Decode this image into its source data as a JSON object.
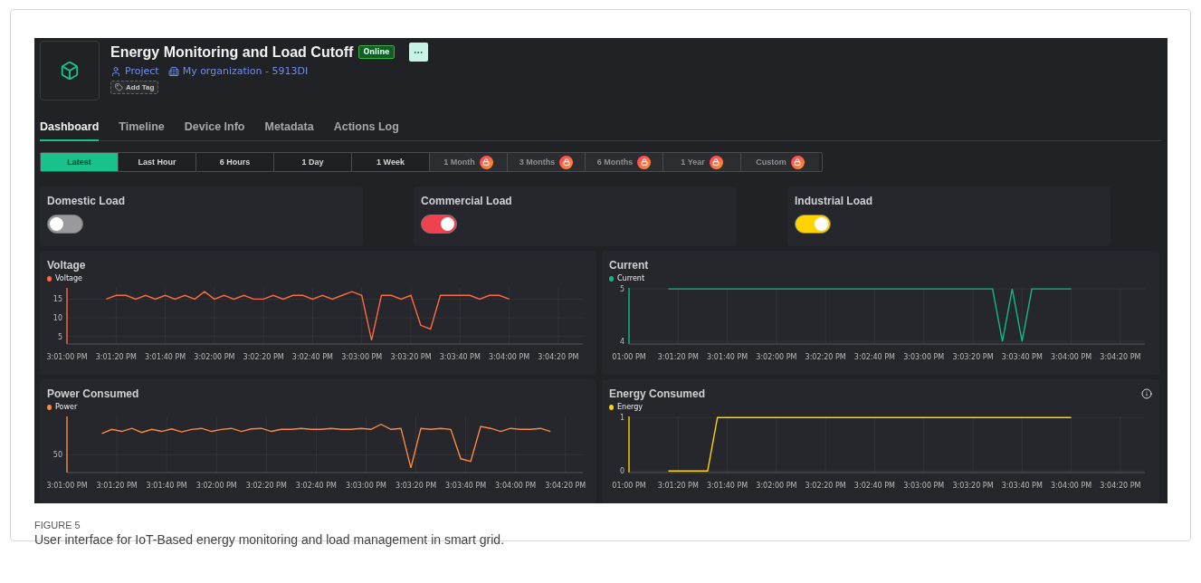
{
  "device": {
    "title": "Energy Monitoring and Load Cutoff",
    "status": "Online",
    "project": "Project",
    "organization": "My organization - 5913DI",
    "add_tag": "Add Tag"
  },
  "tabs": [
    {
      "label": "Dashboard",
      "selected": true
    },
    {
      "label": "Timeline",
      "selected": false
    },
    {
      "label": "Device Info",
      "selected": false
    },
    {
      "label": "Metadata",
      "selected": false
    },
    {
      "label": "Actions Log",
      "selected": false
    }
  ],
  "ranges": [
    {
      "label": "Latest",
      "selected": true,
      "locked": false
    },
    {
      "label": "Last Hour",
      "selected": false,
      "locked": false
    },
    {
      "label": "6 Hours",
      "selected": false,
      "locked": false
    },
    {
      "label": "1 Day",
      "selected": false,
      "locked": false
    },
    {
      "label": "1 Week",
      "selected": false,
      "locked": false
    },
    {
      "label": "1 Month",
      "selected": false,
      "locked": true
    },
    {
      "label": "3 Months",
      "selected": false,
      "locked": true
    },
    {
      "label": "6 Months",
      "selected": false,
      "locked": true
    },
    {
      "label": "1 Year",
      "selected": false,
      "locked": true
    },
    {
      "label": "Custom",
      "selected": false,
      "locked": true
    }
  ],
  "loads": [
    {
      "label": "Domestic Load",
      "on": false
    },
    {
      "label": "Commercial Load",
      "on": true,
      "color": "#f0414f"
    },
    {
      "label": "Industrial Load",
      "on": true,
      "color": "#ffd400"
    }
  ],
  "charts": [
    {
      "title": "Voltage",
      "info": false,
      "chart_data": {
        "type": "line",
        "categories": [
          "3:01:00 PM",
          null,
          null,
          null,
          null,
          "3:01:20 PM",
          null,
          null,
          null,
          null,
          "3:01:40 PM",
          null,
          null,
          null,
          null,
          "3:02:00 PM",
          null,
          null,
          null,
          null,
          "3:02:20 PM",
          null,
          null,
          null,
          null,
          "3:02:40 PM",
          null,
          null,
          null,
          null,
          "3:03:00 PM",
          null,
          null,
          null,
          null,
          "3:03:20 PM",
          null,
          null,
          null,
          null,
          "3:03:40 PM",
          null,
          null,
          null,
          null,
          "3:04:00 PM",
          null,
          null,
          null,
          null,
          "3:04:20 PM",
          null
        ],
        "series": [
          {
            "name": "Voltage",
            "color": "#ff6a3d",
            "values": [
              null,
              null,
              null,
              null,
              15,
              16,
              16,
              15,
              16,
              15,
              16,
              15,
              16,
              15,
              17,
              15,
              16,
              15,
              16,
              15,
              15,
              16,
              15,
              16,
              16,
              15,
              16,
              15,
              16,
              17,
              16,
              4,
              16,
              16,
              15,
              16,
              8,
              7,
              16,
              16,
              16,
              16,
              15,
              16,
              16,
              15,
              null,
              null,
              null,
              null,
              null,
              null
            ]
          }
        ],
        "ylim": [
          3,
          18
        ],
        "yticks": [
          5,
          10,
          15
        ],
        "grid": true
      }
    },
    {
      "title": "Current",
      "info": false,
      "chart_data": {
        "type": "line",
        "categories": [
          "01:00 PM",
          null,
          null,
          null,
          null,
          "3:01:20 PM",
          null,
          null,
          null,
          null,
          "3:01:40 PM",
          null,
          null,
          null,
          null,
          "3:02:00 PM",
          null,
          null,
          null,
          null,
          "3:02:20 PM",
          null,
          null,
          null,
          null,
          "3:02:40 PM",
          null,
          null,
          null,
          null,
          "3:03:00 PM",
          null,
          null,
          null,
          null,
          "3:03:20 PM",
          null,
          null,
          null,
          null,
          "3:03:40 PM",
          null,
          null,
          null,
          null,
          "3:04:00 PM",
          null,
          null,
          null,
          null,
          "3:04:20 PM",
          null
        ],
        "series": [
          {
            "name": "Current",
            "color": "#10b98a",
            "values": [
              null,
              null,
              null,
              null,
              5,
              5,
              5,
              5,
              5,
              5,
              5,
              5,
              5,
              5,
              5,
              5,
              5,
              5,
              5,
              5,
              5,
              5,
              5,
              5,
              5,
              5,
              5,
              5,
              5,
              5,
              5,
              5,
              5,
              5,
              5,
              5,
              5,
              5,
              4,
              5,
              4,
              5,
              5,
              5,
              5,
              5,
              null,
              null,
              null,
              null,
              null,
              null
            ]
          }
        ],
        "ylim": [
          3.95,
          5.02
        ],
        "yticks": [
          4,
          5
        ],
        "grid": true
      }
    },
    {
      "title": "Power Consumed",
      "info": false,
      "plot": {
        "legend": "Power",
        "color": "#ff8a3d",
        "y_label": "50",
        "x_labels": [
          "3:01:00 PM",
          "3:01:20 PM",
          "3:01:40 PM",
          "3:02:00 PM",
          "3:02:20 PM",
          "3:02:40 PM",
          "3:03:00 PM",
          "3:03:20 PM",
          "3:03:40 PM",
          "3:04:00 PM",
          "3:04:20 PM"
        ]
      }
    },
    {
      "title": "Energy Consumed",
      "info": true,
      "chart_data": {
        "type": "line",
        "categories": [
          "01:00 PM",
          null,
          null,
          null,
          null,
          "3:01:20 PM",
          null,
          null,
          null,
          null,
          "3:01:40 PM",
          null,
          null,
          null,
          null,
          "3:02:00 PM",
          null,
          null,
          null,
          null,
          "3:02:20 PM",
          null,
          null,
          null,
          null,
          "3:02:40 PM",
          null,
          null,
          null,
          null,
          "3:03:00 PM",
          null,
          null,
          null,
          null,
          "3:03:20 PM",
          null,
          null,
          null,
          null,
          "3:03:40 PM",
          null,
          null,
          null,
          null,
          "3:04:00 PM",
          null,
          null,
          null,
          null,
          "3:04:20 PM",
          null
        ],
        "series": [
          {
            "name": "Energy",
            "color": "#ffd400",
            "values": [
              null,
              null,
              null,
              null,
              0,
              0,
              0,
              0,
              0,
              1,
              1,
              1,
              1,
              1,
              1,
              1,
              1,
              1,
              1,
              1,
              1,
              1,
              1,
              1,
              1,
              1,
              1,
              1,
              1,
              1,
              1,
              1,
              1,
              1,
              1,
              1,
              1,
              1,
              1,
              1,
              1,
              1,
              1,
              1,
              1,
              1,
              null,
              null,
              null,
              null,
              null,
              null
            ]
          }
        ],
        "ylim": [
          -0.03,
          1.02
        ],
        "yticks": [
          0,
          1
        ],
        "grid": true
      }
    }
  ],
  "caption": {
    "label": "FIGURE 5",
    "text": "User interface for IoT-Based energy monitoring and load management in smart grid."
  }
}
